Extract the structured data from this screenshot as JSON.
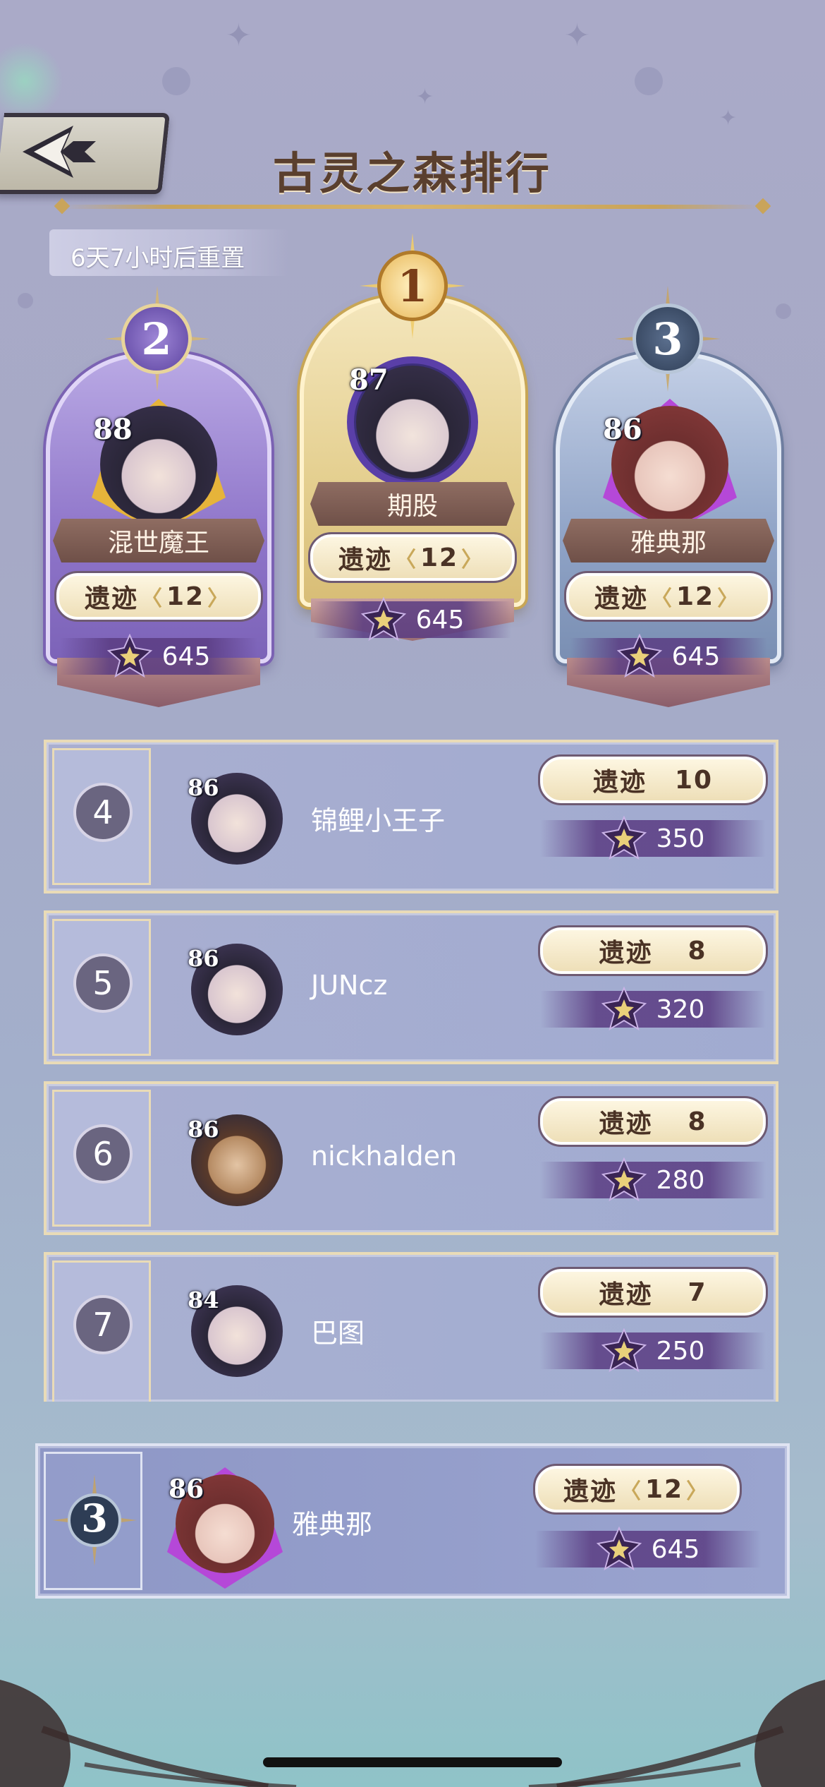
{
  "header": {
    "title": "古灵之森排行",
    "reset_text": "6天7小时后重置"
  },
  "podium": [
    {
      "rank": "2",
      "level": "88",
      "name": "混世魔王",
      "relic_label": "遗迹",
      "relic_value": "12",
      "score": "645",
      "theme": "silver"
    },
    {
      "rank": "1",
      "level": "87",
      "name": "期股",
      "relic_label": "遗迹",
      "relic_value": "12",
      "score": "645",
      "theme": "gold"
    },
    {
      "rank": "3",
      "level": "86",
      "name": "雅典那",
      "relic_label": "遗迹",
      "relic_value": "12",
      "score": "645",
      "theme": "bronze"
    }
  ],
  "list": [
    {
      "rank": "4",
      "level": "86",
      "name": "锦鲤小王子",
      "relic_label": "遗迹",
      "relic_value": "10",
      "score": "350"
    },
    {
      "rank": "5",
      "level": "86",
      "name": "JUNcz",
      "relic_label": "遗迹",
      "relic_value": "8",
      "score": "320"
    },
    {
      "rank": "6",
      "level": "86",
      "name": "nickhalden",
      "relic_label": "遗迹",
      "relic_value": "8",
      "score": "280"
    },
    {
      "rank": "7",
      "level": "84",
      "name": "巴图",
      "relic_label": "遗迹",
      "relic_value": "7",
      "score": "250"
    }
  ],
  "self": {
    "rank": "3",
    "level": "86",
    "name": "雅典那",
    "relic_label": "遗迹",
    "relic_value": "12",
    "score": "645"
  },
  "colors": {
    "gold": "#d8bd76",
    "silver": "#8e74c9",
    "bronze": "#7a8fb3",
    "score_band": "#5a3c82"
  },
  "icons": [
    "back-arrow-icon",
    "rank-medal-icon",
    "star-badge-icon",
    "sparkle-icon"
  ]
}
